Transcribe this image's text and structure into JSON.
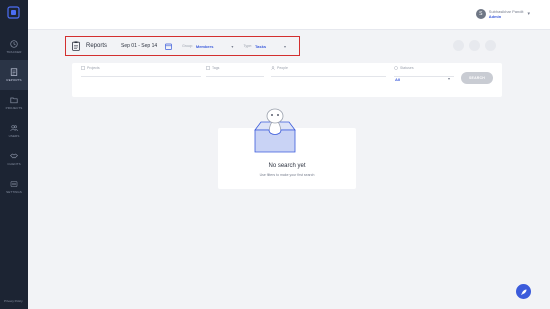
{
  "sidebar": {
    "items": [
      {
        "label": "TRACKER",
        "icon": "clock-icon"
      },
      {
        "label": "REPORTS",
        "icon": "reports-icon",
        "active": true
      },
      {
        "label": "PROJECTS",
        "icon": "folder-icon"
      },
      {
        "label": "USERS",
        "icon": "users-icon"
      },
      {
        "label": "CLIENTS",
        "icon": "handshake-icon"
      },
      {
        "label": "SETTINGS",
        "icon": "gear-icon"
      }
    ],
    "privacy": "Privacy Policy"
  },
  "user": {
    "initial": "S",
    "name": "Subhasikhar Pandit",
    "role": "Admin"
  },
  "reports": {
    "title": "Reports",
    "date_range": "Sep 01 - Sep 14",
    "group_label": "Group:",
    "group_value": "Members",
    "type_label": "Type:",
    "type_value": "Tasks"
  },
  "filters": {
    "projects_label": "Projects",
    "tags_label": "Tags",
    "people_label": "People",
    "status_label": "Statuses",
    "status_value": "All",
    "search_button": "SEARCH"
  },
  "empty_state": {
    "title": "No search yet",
    "subtitle": "Use filters to make your first search"
  },
  "colors": {
    "accent": "#3b5bdb",
    "sidebar": "#1c2433",
    "highlight_border": "#d32f2f"
  }
}
